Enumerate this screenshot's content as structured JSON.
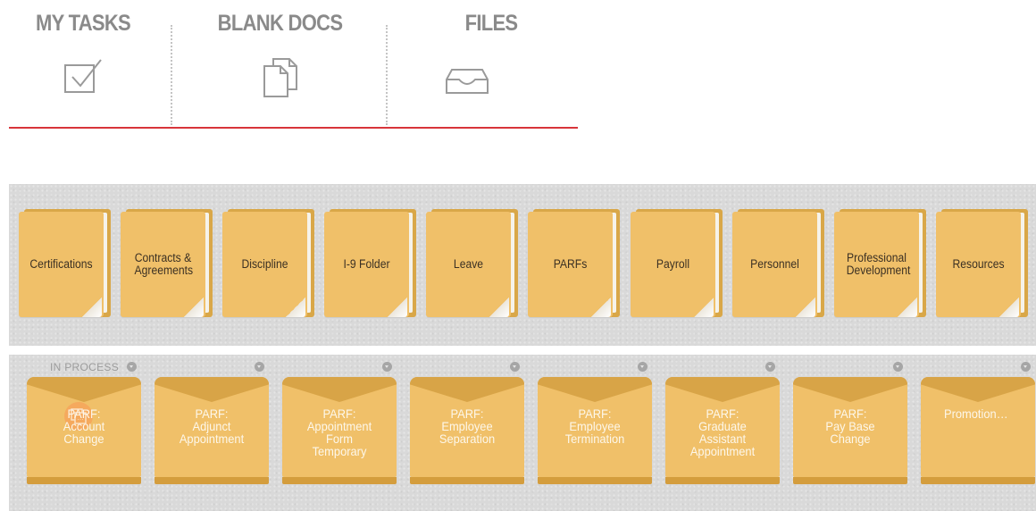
{
  "nav": {
    "tabs": [
      {
        "label": "MY TASKS",
        "icon": "checkbox-icon"
      },
      {
        "label": "BLANK DOCS",
        "icon": "documents-icon"
      },
      {
        "label": "FILES",
        "icon": "inbox-tray-icon"
      }
    ],
    "accent_color": "#d8353a"
  },
  "folders": [
    {
      "label": "Certifications"
    },
    {
      "label": "Contracts & Agreements"
    },
    {
      "label": "Discipline"
    },
    {
      "label": "I-9 Folder"
    },
    {
      "label": "Leave"
    },
    {
      "label": "PARFs"
    },
    {
      "label": "Payroll"
    },
    {
      "label": "Personnel"
    },
    {
      "label": "Professional Development"
    },
    {
      "label": "Resources"
    }
  ],
  "envelopes": [
    {
      "label": "PARF: Account Change",
      "status": "IN PROCESS"
    },
    {
      "label": "PARF: Adjunct Appointment"
    },
    {
      "label": "PARF: Appointment Form Temporary"
    },
    {
      "label": "PARF: Employee Separation"
    },
    {
      "label": "PARF: Employee Termination"
    },
    {
      "label": "PARF: Graduate Assistant Appointment"
    },
    {
      "label": "PARF: Pay Base Change"
    },
    {
      "label": "Promotion…"
    }
  ],
  "colors": {
    "folder": "#f0c069",
    "folder_dark": "#d9a748",
    "envelope": "#f0c069",
    "envelope_text": "#fdf7ea",
    "shelf": "#d9d9d9"
  }
}
